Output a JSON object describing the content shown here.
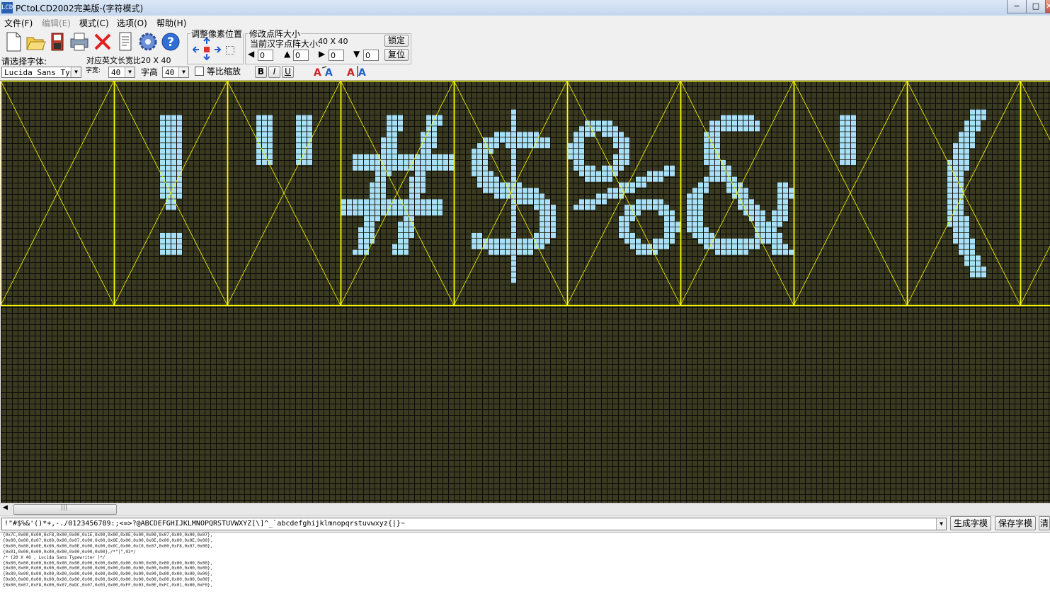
{
  "window": {
    "title": "PCtoLCD2002完美版-(字符模式)",
    "app_icon": "lcd-app-icon",
    "controls": [
      "−",
      "□",
      "✕"
    ]
  },
  "menu": [
    {
      "label": "文件(F)",
      "enabled": true
    },
    {
      "label": "编辑(E)",
      "enabled": false
    },
    {
      "label": "模式(C)",
      "enabled": true
    },
    {
      "label": "选项(O)",
      "enabled": true
    },
    {
      "label": "帮助(H)",
      "enabled": true
    }
  ],
  "toolbar": {
    "icons": [
      "new-file-icon",
      "open-folder-icon",
      "save-icon",
      "print-icon",
      "delete-icon",
      "document-icon",
      "settings-gear-icon",
      "help-icon"
    ],
    "adjust_pixel_title": "调整像素位置",
    "resize_title": "修改点阵大小",
    "current_size_label": "当前汉字点阵大小:",
    "current_size_value": "40  X  40",
    "lock_button": "锁定",
    "reset_button": "复位",
    "spin_values": [
      "0",
      "0",
      "0",
      "0"
    ],
    "font_select_label": "请选择字体:",
    "ratio_label": "对应英文长宽比",
    "ratio_value": "20  X  40",
    "font_name": "Lucida Sans Typewriter",
    "width_label": "字宽:",
    "width_value": "40",
    "height_label": "字高",
    "height_value": "40",
    "proportional_label": "等比缩放",
    "proportional_checked": false,
    "bold": "B",
    "italic": "I",
    "underline": "U"
  },
  "canvas": {
    "glyphs": [
      " ",
      "!",
      "\"",
      "#",
      "$",
      "%",
      "&",
      "'",
      "(",
      ")"
    ],
    "background": "#3a3a21",
    "pixel_color": "#a8e0f8",
    "guide_color": "#ffff00"
  },
  "char_input": {
    "value": "!\"#$%&'()*+,-./0123456789:;<=>?@ABCDEFGHIJKLMNOPQRSTUVWXYZ[\\]^_`abcdefghijklmnopqrstuvwxyz{|}~",
    "generate_button": "生成字模",
    "save_button": "保存字模",
    "clear_button": "清"
  },
  "output_lines": [
    "{0x7C,0x00,0x00,0xF8,0x00,0x00,0x1E,0x00,0x00,0x0E,0x00,0x00,0x07,0x00,0x00,0x07},",
    "{0x00,0x00,0x07,0x00,0x00,0x07,0x00,0x00,0x0E,0x00,0x00,0x0E,0x00,0x00,0x0E,0x00},",
    "{0x00,0x00,0x0E,0x00,0x00,0x0E,0x00,0x00,0x0C,0x00,0xC0,0x07,0x00,0xF8,0x07,0x00},",
    "{0x01,0x00,0x00,0x00,0x00,0x00,0x00,0x00},/*\"|\",93*/",
    "/* (20 X 40 , Lucida Sans Typewriter )*/",
    "{0x00,0x00,0x00,0x00,0x00,0x00,0x00,0x00,0x00,0x00,0x00,0x00,0x00,0x00,0x00,0x00},",
    "{0x00,0x00,0x00,0x00,0x00,0x00,0x00,0x00,0x00,0x00,0x00,0x00,0x00,0x00,0x00,0x00},",
    "{0x00,0x00,0x00,0x00,0x00,0x00,0x00,0x00,0x00,0x00,0x00,0x00,0x00,0x00,0x00,0x00},",
    "{0x00,0x00,0x00,0x00,0x00,0x00,0x00,0x00,0x00,0x00,0x00,0x00,0x00,0x00,0x00,0x00},",
    "{0x00,0x07,0xF8,0x00,0x07,0xDC,0x07,0x03,0x00,0xFF,0x03,0x0E,0xFC,0x01,0x00,0xF0},"
  ]
}
